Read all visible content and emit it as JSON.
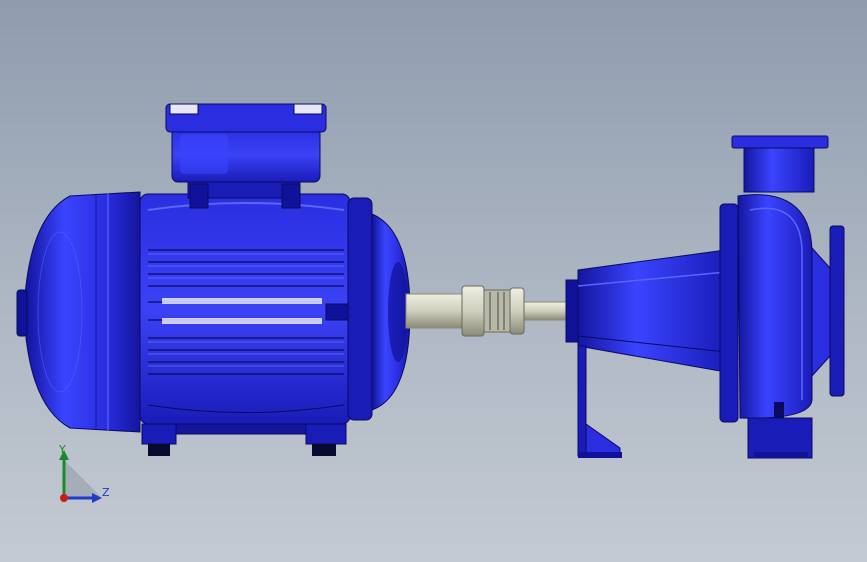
{
  "viewport": {
    "background_top": "#8e9cae",
    "background_bottom": "#c4cad3"
  },
  "model": {
    "colors": {
      "body": "#2a2ee0",
      "body_dark": "#10129a",
      "body_light": "#5a64ff",
      "edge": "#0a0a60",
      "shaft": "#d8d8c8",
      "shaft_dark": "#8a8a78"
    },
    "parts": [
      "motor-fan-cover",
      "motor-housing",
      "terminal-box",
      "motor-flange",
      "shaft",
      "coupling",
      "bearing-bracket",
      "pump-casing",
      "discharge-flange",
      "suction-flange",
      "support-foot"
    ]
  },
  "triad": {
    "y_label": "Y",
    "z_label": "Z",
    "y_color": "#1c8a2a",
    "z_color": "#1e3cc8",
    "origin_color": "#d01818"
  }
}
